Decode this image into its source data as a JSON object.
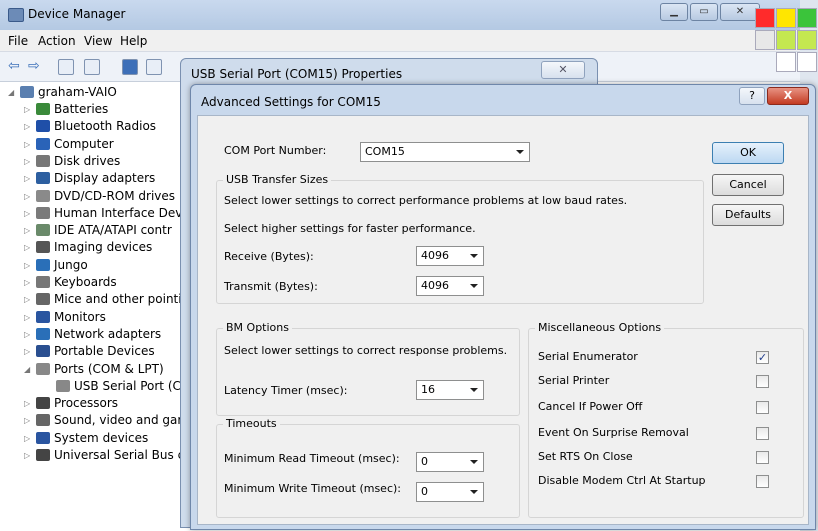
{
  "device_manager": {
    "title": "Device Manager",
    "menu": [
      "File",
      "Action",
      "View",
      "Help"
    ],
    "tree": {
      "root": "graham-VAIO",
      "items": [
        {
          "label": "Batteries",
          "color": "#3a8a3a"
        },
        {
          "label": "Bluetooth Radios",
          "color": "#1f4fa8"
        },
        {
          "label": "Computer",
          "color": "#2a63b8"
        },
        {
          "label": "Disk drives",
          "color": "#777777"
        },
        {
          "label": "Display adapters",
          "color": "#2d5fa0"
        },
        {
          "label": "DVD/CD-ROM drives",
          "color": "#8a8a8a"
        },
        {
          "label": "Human Interface Devi",
          "color": "#7a7a7a"
        },
        {
          "label": "IDE ATA/ATAPI contr",
          "color": "#6a8a6a"
        },
        {
          "label": "Imaging devices",
          "color": "#555555"
        },
        {
          "label": "Jungo",
          "color": "#2a6fb8"
        },
        {
          "label": "Keyboards",
          "color": "#777777"
        },
        {
          "label": "Mice and other pointi",
          "color": "#666666"
        },
        {
          "label": "Monitors",
          "color": "#2a55a0"
        },
        {
          "label": "Network adapters",
          "color": "#2a6fb8"
        },
        {
          "label": "Portable Devices",
          "color": "#2a4f90"
        },
        {
          "label": "Ports (COM & LPT)",
          "color": "#888888"
        },
        {
          "label": "USB Serial Port (C",
          "color": "#888888",
          "child": true
        },
        {
          "label": "Processors",
          "color": "#444444"
        },
        {
          "label": "Sound, video and gar",
          "color": "#666666"
        },
        {
          "label": "System devices",
          "color": "#2a55a0"
        },
        {
          "label": "Universal Serial Bus c",
          "color": "#444444"
        }
      ]
    }
  },
  "properties": {
    "title": "USB Serial Port (COM15) Properties",
    "close_label": "✕"
  },
  "advanced": {
    "title": "Advanced Settings for COM15",
    "help_label": "?",
    "close_label": "X",
    "com_port_label": "COM Port Number:",
    "com_port_value": "COM15",
    "usb_group_title": "USB Transfer Sizes",
    "usb_line1": "Select lower settings to correct performance problems at low baud rates.",
    "usb_line2": "Select higher settings for faster performance.",
    "receive_label": "Receive (Bytes):",
    "receive_value": "4096",
    "transmit_label": "Transmit (Bytes):",
    "transmit_value": "4096",
    "bm_group_title": "BM Options",
    "bm_line": "Select lower settings to correct response problems.",
    "latency_label": "Latency Timer (msec):",
    "latency_value": "16",
    "timeouts_group_title": "Timeouts",
    "read_timeout_label": "Minimum Read Timeout (msec):",
    "read_timeout_value": "0",
    "write_timeout_label": "Minimum Write Timeout (msec):",
    "write_timeout_value": "0",
    "misc_group_title": "Miscellaneous Options",
    "misc_options": [
      {
        "label": "Serial Enumerator",
        "checked": true
      },
      {
        "label": "Serial Printer",
        "checked": false
      },
      {
        "label": "Cancel If Power Off",
        "checked": false
      },
      {
        "label": "Event On Surprise Removal",
        "checked": false
      },
      {
        "label": "Set RTS On Close",
        "checked": false
      },
      {
        "label": "Disable Modem Ctrl At Startup",
        "checked": false
      }
    ],
    "ok_label": "OK",
    "cancel_label": "Cancel",
    "defaults_label": "Defaults"
  },
  "swatches": [
    "#ff2b2b",
    "#ffe600",
    "#3bc43b",
    "#e8e8e8",
    "#c4e850",
    "#c4e850"
  ]
}
